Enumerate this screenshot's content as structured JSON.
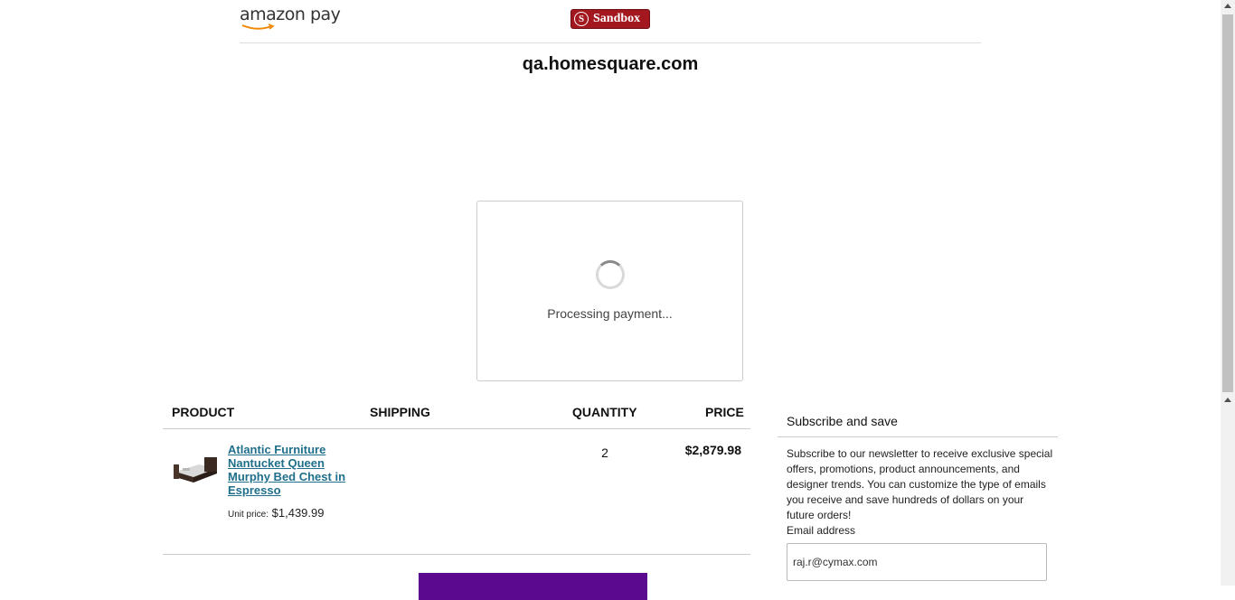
{
  "header": {
    "logo_text": "amazon pay",
    "sandbox_icon_letter": "S",
    "sandbox_label": "Sandbox"
  },
  "merchant": "qa.homesquare.com",
  "modal": {
    "status_text": "Processing payment..."
  },
  "cart": {
    "columns": [
      "PRODUCT",
      "SHIPPING",
      "QUANTITY",
      "PRICE"
    ],
    "items": [
      {
        "name": "Atlantic Furniture Nantucket Queen Murphy Bed Chest in Espresso",
        "unit_price_label": "Unit price:",
        "unit_price": "$1,439.99",
        "quantity": "2",
        "price": "$2,879.98"
      }
    ]
  },
  "newsletter": {
    "title": "Subscribe and save",
    "text": "Subscribe to our newsletter to receive exclusive special offers, promotions, product announcements, and designer trends. You can customize the type of emails you receive and save hundreds of dollars on your future orders!",
    "email_label": "Email address",
    "email_value": "raj.r@cymax.com"
  },
  "colors": {
    "sandbox_bg": "#a3181f",
    "link": "#1f6f8b",
    "checkout_button": "#5b0a8f"
  }
}
